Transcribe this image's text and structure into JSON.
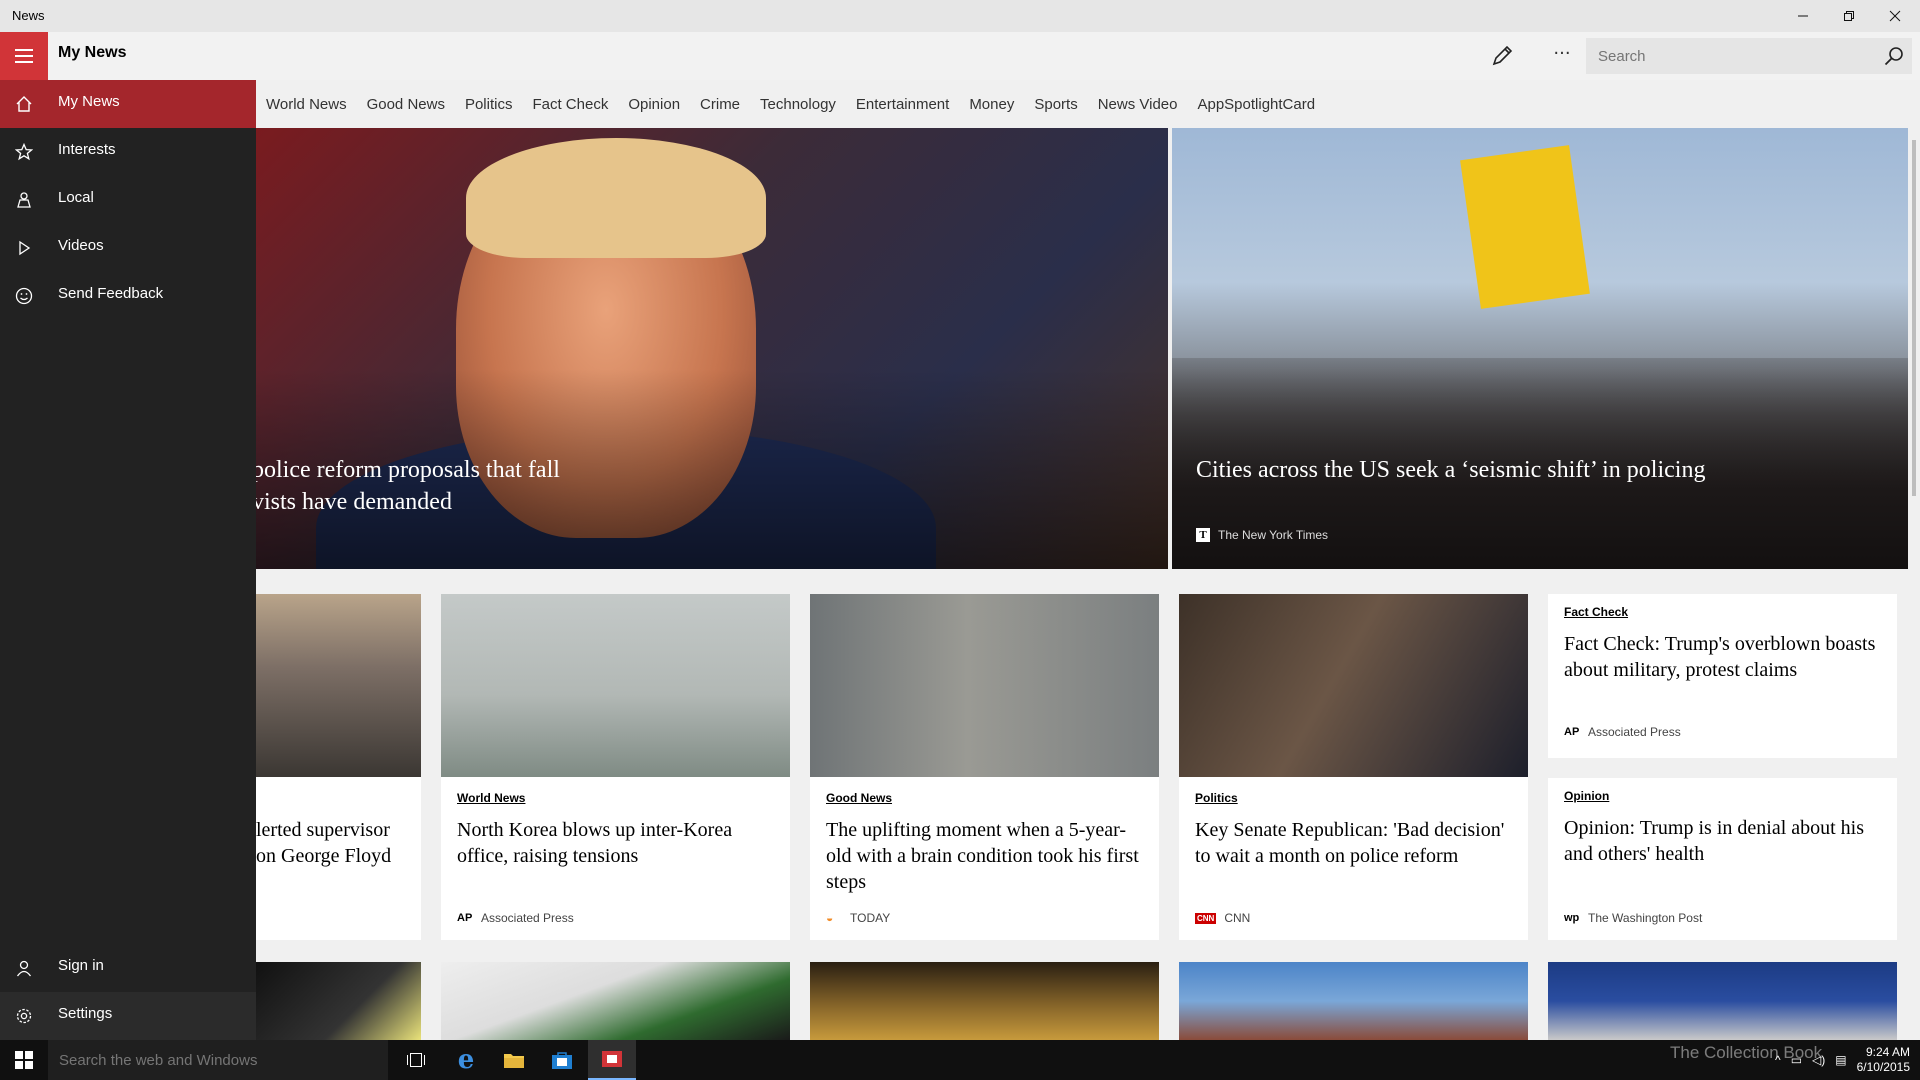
{
  "window": {
    "title": "News"
  },
  "header": {
    "title": "My News"
  },
  "search": {
    "placeholder": "Search"
  },
  "sidebar": {
    "items": [
      {
        "label": "My News"
      },
      {
        "label": "Interests"
      },
      {
        "label": "Local"
      },
      {
        "label": "Videos"
      },
      {
        "label": "Send Feedback"
      }
    ],
    "bottom": [
      {
        "label": "Sign in"
      },
      {
        "label": "Settings"
      }
    ]
  },
  "tabs": [
    "World News",
    "Good News",
    "Politics",
    "Fact Check",
    "Opinion",
    "Crime",
    "Technology",
    "Entertainment",
    "Money",
    "Sports",
    "News Video",
    "AppSpotlightCard"
  ],
  "heroes": [
    {
      "title": "police reform proposals that fall\nvists have demanded"
    },
    {
      "title": "Cities across the US seek a ‘seismic shift’ in policing",
      "source": "The New York Times"
    }
  ],
  "cards": [
    {
      "title": "lerted supervisor\n on George Floyd"
    },
    {
      "category": "World News",
      "title": "North Korea blows up inter-Korea office, raising tensions",
      "source": "Associated Press",
      "logo": "AP"
    },
    {
      "category": "Good News",
      "title": "The uplifting moment when a 5-year-old with a brain condition took his first steps",
      "source": "TODAY"
    },
    {
      "category": "Politics",
      "title": "Key Senate Republican: 'Bad decision' to wait a month on police reform",
      "source": "CNN",
      "logo": "CNN"
    },
    {
      "category": "Fact Check",
      "title": "Fact Check: Trump's overblown boasts about military, protest claims",
      "source": "Associated Press",
      "logo": "AP"
    },
    {
      "category": "Opinion",
      "title": "Opinion: Trump is in denial about his and others' health",
      "source": "The Washington Post",
      "logo": "wp"
    }
  ],
  "taskbar": {
    "search_placeholder": "Search the web and Windows",
    "time": "9:24 AM",
    "date": "6/10/2015",
    "watermark": "The Collection Book"
  },
  "colors": {
    "accent": "#d13438",
    "active_nav": "#a4262c",
    "sidebar": "#222222"
  }
}
